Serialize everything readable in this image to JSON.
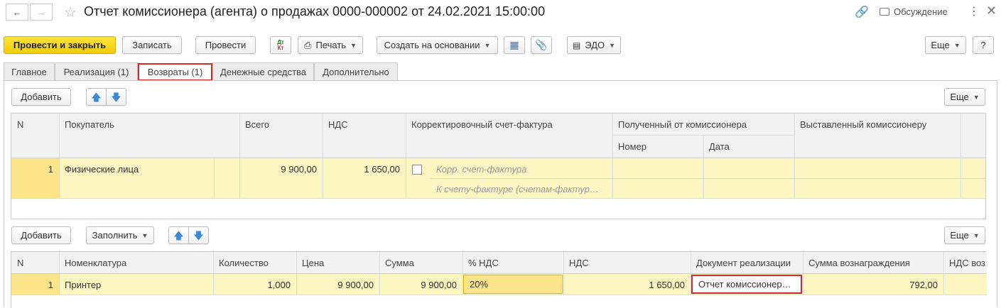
{
  "header": {
    "title": "Отчет комиссионера (агента) о продажах 0000-000002 от 24.02.2021 15:00:00",
    "discussion_label": "Обсуждение"
  },
  "toolbar": {
    "post_close": "Провести и закрыть",
    "save": "Записать",
    "post": "Провести",
    "print": "Печать",
    "create_based": "Создать на основании",
    "edo": "ЭДО",
    "more": "Еще",
    "help": "?"
  },
  "tabs": [
    {
      "label": "Главное"
    },
    {
      "label": "Реализация (1)"
    },
    {
      "label": "Возвраты (1)"
    },
    {
      "label": "Денежные средства"
    },
    {
      "label": "Дополнительно"
    }
  ],
  "returns": {
    "add_label": "Добавить",
    "more_label": "Еще",
    "columns": {
      "n": "N",
      "buyer": "Покупатель",
      "total": "Всего",
      "vat": "НДС",
      "corr_invoice": "Корректировочный счет-фактура",
      "received_from": "Полученный от комиссионера",
      "number": "Номер",
      "date": "Дата",
      "issued_to": "Выставленный комиссионеру"
    },
    "row": {
      "n": "1",
      "buyer": "Физические лица",
      "total": "9 900,00",
      "vat": "1 650,00",
      "corr_placeholder": "Корр. счет-фактура",
      "corr_to_placeholder": "К счету-фактуре (счетам-фактур…"
    }
  },
  "goods": {
    "add_label": "Добавить",
    "fill_label": "Заполнить",
    "more_label": "Еще",
    "columns": {
      "n": "N",
      "item": "Номенклатура",
      "qty": "Количество",
      "price": "Цена",
      "sum": "Сумма",
      "vat_rate": "% НДС",
      "vat": "НДС",
      "doc": "Документ реализации",
      "reward": "Сумма вознаграждения",
      "reward_vat": "НДС воз"
    },
    "row": {
      "n": "1",
      "item": "Принтер",
      "qty": "1,000",
      "price": "9 900,00",
      "sum": "9 900,00",
      "vat_rate": "20%",
      "vat": "1 650,00",
      "doc": "Отчет комиссионера…",
      "reward": "792,00"
    }
  },
  "colors": {
    "primary_button": "#f2cd0a",
    "row_highlight": "#fdf6c3",
    "cell_highlight": "#fbe48a",
    "active_tab_border": "#d22a2a",
    "arrow_icon": "#3d87d3"
  }
}
